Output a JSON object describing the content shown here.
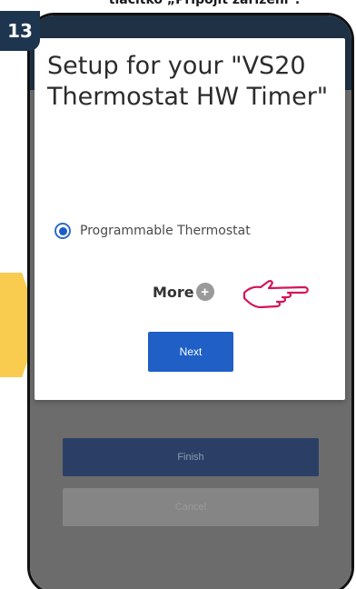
{
  "caption": "tlačítko „Připojit zařízení\".",
  "step_number": "13",
  "dialog": {
    "title": "Setup for your \"VS20 Thermostat HW Timer\"",
    "option_label": "Programmable Thermostat",
    "more_label": "More",
    "more_icon": "plus-icon",
    "next_label": "Next"
  },
  "background_buttons": {
    "finish_label": "Finish",
    "cancel_label": "Cancel"
  },
  "colors": {
    "badge": "#1e3550",
    "arrow": "#f9cb4f",
    "primary": "#1f5fc6",
    "hand_outline": "#d4145a"
  }
}
